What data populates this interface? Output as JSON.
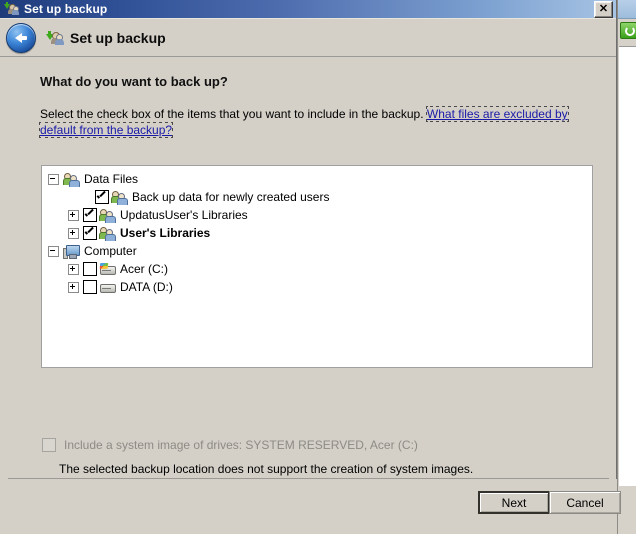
{
  "window": {
    "title": "Set up backup",
    "title_icon": "backup-users-icon",
    "close_label": "✕"
  },
  "header": {
    "back_icon": "back-arrow-icon",
    "icon": "backup-users-icon",
    "title": "Set up backup"
  },
  "page": {
    "heading": "What do you want to back up?",
    "instructions_text": "Select the check box of the items that you want to include in the backup. ",
    "instructions_link": "What files are excluded by default from the backup?"
  },
  "tree": {
    "rows": [
      {
        "label": "Data Files",
        "indent": 6,
        "expander": "minus",
        "checkbox": "none",
        "icon": "users-icon",
        "bold": false
      },
      {
        "label": "Back up data for newly created users",
        "indent": 40,
        "expander": "none",
        "checkbox": "checked",
        "icon": "users-icon",
        "bold": false
      },
      {
        "label": "UpdatusUser's Libraries",
        "indent": 26,
        "expander": "plus",
        "checkbox": "checked",
        "icon": "users-icon",
        "bold": false
      },
      {
        "label": "User's Libraries",
        "indent": 26,
        "expander": "plus",
        "checkbox": "checked",
        "icon": "users-icon",
        "bold": true
      },
      {
        "label": "Computer",
        "indent": 6,
        "expander": "minus",
        "checkbox": "none",
        "icon": "computer-icon",
        "bold": false
      },
      {
        "label": "Acer (C:)",
        "indent": 26,
        "expander": "plus",
        "checkbox": "unchecked",
        "icon": "system-drive-icon",
        "bold": false
      },
      {
        "label": "DATA (D:)",
        "indent": 26,
        "expander": "plus",
        "checkbox": "unchecked",
        "icon": "drive-icon",
        "bold": false
      }
    ]
  },
  "system_image": {
    "checkbox_state": "unchecked-disabled",
    "label": "Include a system image of drives: SYSTEM RESERVED, Acer (C:)",
    "note": "The selected backup location does not support the creation of system images."
  },
  "footer": {
    "next_label": "Next",
    "cancel_label": "Cancel"
  },
  "colors": {
    "titlebar_start": "#1f3c7a",
    "titlebar_end": "#a8c4e4",
    "dialog_face": "#d4d0c8",
    "link": "#1a1aa8",
    "disabled_text": "#8d8b85"
  }
}
